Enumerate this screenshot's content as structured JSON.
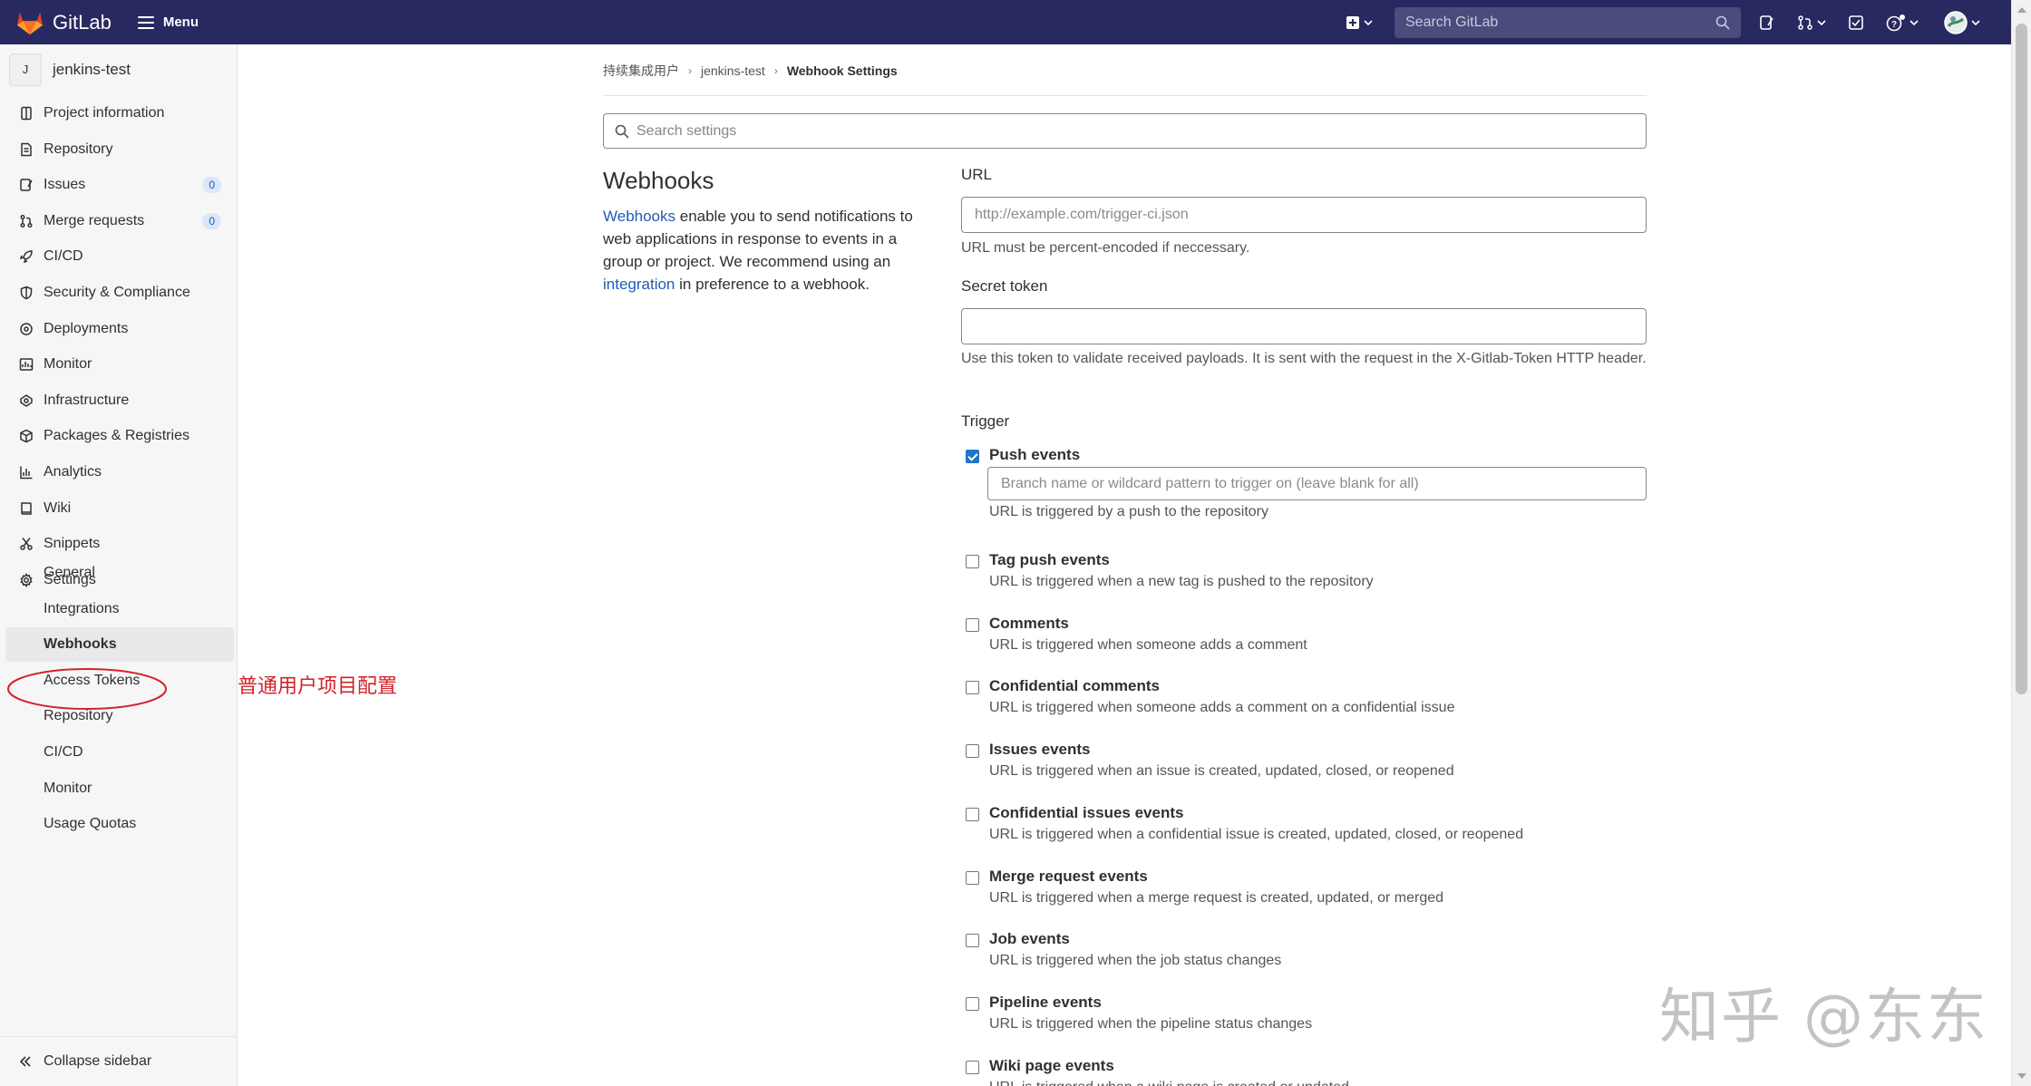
{
  "topbar": {
    "brand": "GitLab",
    "menu_label": "Menu",
    "search_placeholder": "Search GitLab",
    "icons": [
      "plus-square-icon",
      "search-icon",
      "issues-icon",
      "merge-request-icon",
      "todo-icon",
      "help-icon",
      "avatar"
    ]
  },
  "sidebar": {
    "project_initial": "J",
    "project_name": "jenkins-test",
    "items": [
      {
        "label": "Project information",
        "icon": "info-icon"
      },
      {
        "label": "Repository",
        "icon": "doc-icon"
      },
      {
        "label": "Issues",
        "icon": "issues-icon",
        "badge": "0"
      },
      {
        "label": "Merge requests",
        "icon": "merge-request-icon",
        "badge": "0"
      },
      {
        "label": "CI/CD",
        "icon": "rocket-icon"
      },
      {
        "label": "Security & Compliance",
        "icon": "shield-icon"
      },
      {
        "label": "Deployments",
        "icon": "deployments-icon"
      },
      {
        "label": "Monitor",
        "icon": "monitor-icon"
      },
      {
        "label": "Infrastructure",
        "icon": "cloud-icon"
      },
      {
        "label": "Packages & Registries",
        "icon": "package-icon"
      },
      {
        "label": "Analytics",
        "icon": "chart-icon"
      },
      {
        "label": "Wiki",
        "icon": "book-icon"
      },
      {
        "label": "Snippets",
        "icon": "scissors-icon"
      },
      {
        "label": "Settings",
        "icon": "gear-icon"
      }
    ],
    "settings_sub": [
      "General",
      "Integrations",
      "Webhooks",
      "Access Tokens",
      "Repository",
      "CI/CD",
      "Monitor",
      "Usage Quotas"
    ],
    "active_sub": "Webhooks",
    "collapse_label": "Collapse sidebar"
  },
  "annotation": {
    "text": "普通用户项目配置",
    "color": "#d2232b"
  },
  "breadcrumb": [
    "持续集成用户",
    "jenkins-test",
    "Webhook Settings"
  ],
  "search_settings_placeholder": "Search settings",
  "section": {
    "title": "Webhooks",
    "desc_link1": "Webhooks",
    "desc_part1": " enable you to send notifications to web applications in response to events in a group or project. We recommend using an ",
    "desc_link2": "integration",
    "desc_part2": " in preference to a webhook."
  },
  "form": {
    "url_label": "URL",
    "url_placeholder": "http://example.com/trigger-ci.json",
    "url_help": "URL must be percent-encoded if neccessary.",
    "token_label": "Secret token",
    "token_value": "",
    "token_help": "Use this token to validate received payloads. It is sent with the request in the X-Gitlab-Token HTTP header.",
    "trigger_label": "Trigger",
    "branch_placeholder": "Branch name or wildcard pattern to trigger on (leave blank for all)",
    "triggers": [
      {
        "title": "Push events",
        "help": "URL is triggered by a push to the repository",
        "checked": true
      },
      {
        "title": "Tag push events",
        "help": "URL is triggered when a new tag is pushed to the repository",
        "checked": false
      },
      {
        "title": "Comments",
        "help": "URL is triggered when someone adds a comment",
        "checked": false
      },
      {
        "title": "Confidential comments",
        "help": "URL is triggered when someone adds a comment on a confidential issue",
        "checked": false
      },
      {
        "title": "Issues events",
        "help": "URL is triggered when an issue is created, updated, closed, or reopened",
        "checked": false
      },
      {
        "title": "Confidential issues events",
        "help": "URL is triggered when a confidential issue is created, updated, closed, or reopened",
        "checked": false
      },
      {
        "title": "Merge request events",
        "help": "URL is triggered when a merge request is created, updated, or merged",
        "checked": false
      },
      {
        "title": "Job events",
        "help": "URL is triggered when the job status changes",
        "checked": false
      },
      {
        "title": "Pipeline events",
        "help": "URL is triggered when the pipeline status changes",
        "checked": false
      },
      {
        "title": "Wiki page events",
        "help": "URL is triggered when a wiki page is created or updated",
        "checked": false
      }
    ]
  },
  "watermark": "知乎 @东东",
  "colors": {
    "navbar": "#292961",
    "link": "#1f5cb5",
    "checkbox": "#1f75cb"
  }
}
